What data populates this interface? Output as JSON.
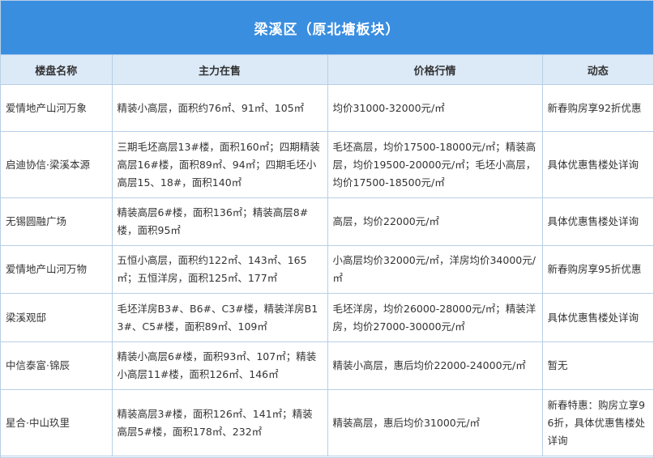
{
  "title": "梁溪区（原北塘板块）",
  "headers": [
    "楼盘名称",
    "主力在售",
    "价格行情",
    "动态"
  ],
  "rows": [
    {
      "name": "爱情地产山河万象",
      "main": "精装小高层，面积约76㎡、91㎡、105㎡",
      "price": "均价31000-32000元/㎡",
      "news": "新春购房享92折优惠"
    },
    {
      "name": "启迪协信·梁溪本源",
      "main": "三期毛坯高层13#楼，面积160㎡；四期精装高层16#楼，面积89㎡、94㎡；四期毛坯小高层15、18#，面积140㎡",
      "price": "毛坯高层，均价17500-18000元/㎡；精装高层，均价19500-20000元/㎡；毛坯小高层，均价17500-18500元/㎡",
      "news": "具体优惠售楼处详询"
    },
    {
      "name": "无锡圆融广场",
      "main": "精装高层6#楼，面积136㎡；精装高层8#楼，面积95㎡",
      "price": "高层，均价22000元/㎡",
      "news": "具体优惠售楼处详询"
    },
    {
      "name": "爱情地产山河万物",
      "main": "五恒小高层，面积约122㎡、143㎡、165㎡；五恒洋房，面积125㎡、177㎡",
      "price": "小高层均价32000元/㎡，洋房均价34000元/㎡",
      "news": "新春购房享95折优惠"
    },
    {
      "name": "梁溪观邸",
      "main": "毛坯洋房B3#、B6#、C3#楼，精装洋房B13#、C5#楼，面积89㎡、109㎡",
      "price": "毛坯洋房，均价26000-28000元/㎡；精装洋房，均价27000-30000元/㎡",
      "news": "具体优惠售楼处详询"
    },
    {
      "name": "中信泰富·锦辰",
      "main": "精装小高层6#楼，面积93㎡、107㎡；精装小高层11#楼，面积126㎡、146㎡",
      "price": "精装小高层，惠后均价22000-24000元/㎡",
      "news": "暂无"
    },
    {
      "name": "星合·中山玖里",
      "main": "精装高层3#楼，面积126㎡、141㎡；精装高层5#楼，面积178㎡、232㎡",
      "price": "精装高层，惠后均价31000元/㎡",
      "news": "新春特惠：购房立享96折，具体优惠售楼处详询"
    }
  ]
}
